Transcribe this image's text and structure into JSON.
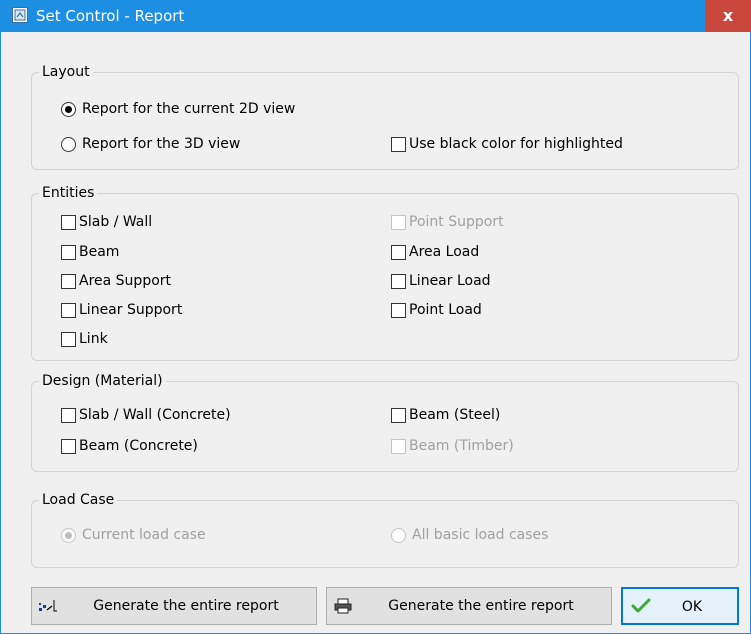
{
  "window": {
    "title": "Set Control - Report",
    "close_glyph": "x",
    "accent_color": "#1c8fe2",
    "close_color": "#c9473d"
  },
  "layout_group": {
    "title": "Layout",
    "current_2d": {
      "label": "Report for the current 2D view",
      "selected": true
    },
    "view_3d": {
      "label": "Report for the 3D view",
      "selected": false
    },
    "black_highlight": {
      "label": "Use black color for highlighted",
      "checked": false
    }
  },
  "entities_group": {
    "title": "Entities",
    "items": [
      {
        "label": "Slab / Wall",
        "checked": false,
        "enabled": true
      },
      {
        "label": "Point Support",
        "checked": false,
        "enabled": false
      },
      {
        "label": "Beam",
        "checked": false,
        "enabled": true
      },
      {
        "label": "Area Load",
        "checked": false,
        "enabled": true
      },
      {
        "label": "Area Support",
        "checked": false,
        "enabled": true
      },
      {
        "label": "Linear Load",
        "checked": false,
        "enabled": true
      },
      {
        "label": "Linear Support",
        "checked": false,
        "enabled": true
      },
      {
        "label": "Point Load",
        "checked": false,
        "enabled": true
      },
      {
        "label": "Link",
        "checked": false,
        "enabled": true
      }
    ]
  },
  "design_group": {
    "title": "Design (Material)",
    "items": [
      {
        "label": "Slab / Wall (Concrete)",
        "checked": false,
        "enabled": true
      },
      {
        "label": "Beam (Steel)",
        "checked": false,
        "enabled": true
      },
      {
        "label": "Beam (Concrete)",
        "checked": false,
        "enabled": true
      },
      {
        "label": "Beam (Timber)",
        "checked": false,
        "enabled": false
      }
    ]
  },
  "loadcase_group": {
    "title": "Load Case",
    "current": {
      "label": "Current load case",
      "selected": true,
      "enabled": false
    },
    "all_basic": {
      "label": "All basic load cases",
      "selected": false,
      "enabled": false
    }
  },
  "buttons": {
    "generate_export": {
      "label": "Generate the entire report",
      "icon": "export-chart-icon"
    },
    "generate_print": {
      "label": "Generate the entire report",
      "icon": "printer-icon"
    },
    "ok": {
      "label": "OK",
      "icon": "checkmark-icon"
    }
  }
}
